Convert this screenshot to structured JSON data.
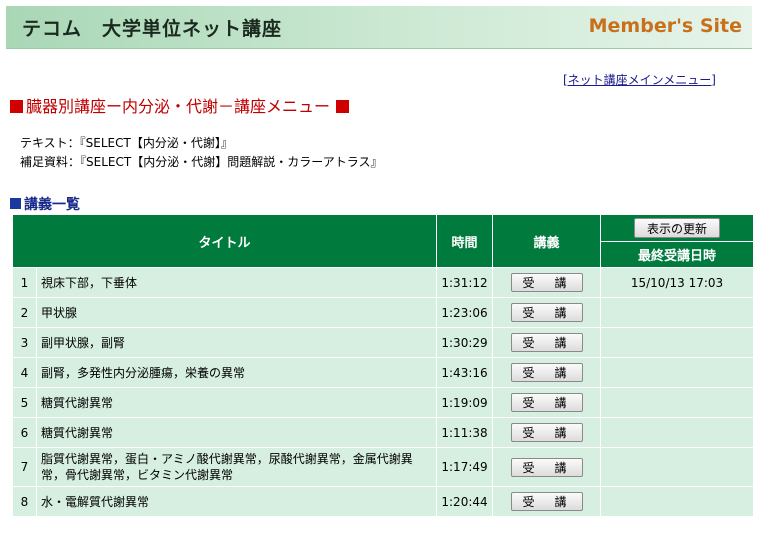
{
  "header": {
    "site_title": "テコム　大学単位ネット講座",
    "member_site": "Member's Site"
  },
  "main_menu_link": "[ネット講座メインメニュー]",
  "page_heading": "臓器別講座ー内分泌・代謝－講座メニュー",
  "texts": {
    "text_label": "テキスト：",
    "text_value": "『SELECT【内分泌・代謝】』",
    "supplement_label": "補足資料：",
    "supplement_value": "『SELECT【内分泌・代謝】問題解説・カラーアトラス』"
  },
  "list_heading": "講義一覧",
  "table": {
    "headers": {
      "title": "タイトル",
      "time": "時間",
      "lecture": "講義",
      "refresh_button": "表示の更新",
      "last_date": "最終受講日時"
    },
    "attend_label": "受　講",
    "rows": [
      {
        "num": "1",
        "title": "視床下部，下垂体",
        "time": "1:31:12",
        "last": "15/10/13 17:03"
      },
      {
        "num": "2",
        "title": "甲状腺",
        "time": "1:23:06",
        "last": ""
      },
      {
        "num": "3",
        "title": "副甲状腺，副腎",
        "time": "1:30:29",
        "last": ""
      },
      {
        "num": "4",
        "title": "副腎，多発性内分泌腫瘍，栄養の異常",
        "time": "1:43:16",
        "last": ""
      },
      {
        "num": "5",
        "title": "糖質代謝異常",
        "time": "1:19:09",
        "last": ""
      },
      {
        "num": "6",
        "title": "糖質代謝異常",
        "time": "1:11:38",
        "last": ""
      },
      {
        "num": "7",
        "title": "脂質代謝異常，蛋白・アミノ酸代謝異常，尿酸代謝異常，金属代謝異常，骨代謝異常，ビタミン代謝異常",
        "time": "1:17:49",
        "last": ""
      },
      {
        "num": "8",
        "title": "水・電解質代謝異常",
        "time": "1:20:44",
        "last": ""
      }
    ]
  },
  "colors": {
    "header_green": "#007a3d",
    "row_bg": "#d6efe0",
    "heading_red": "#c00000",
    "member_site_orange": "#c9701a"
  }
}
